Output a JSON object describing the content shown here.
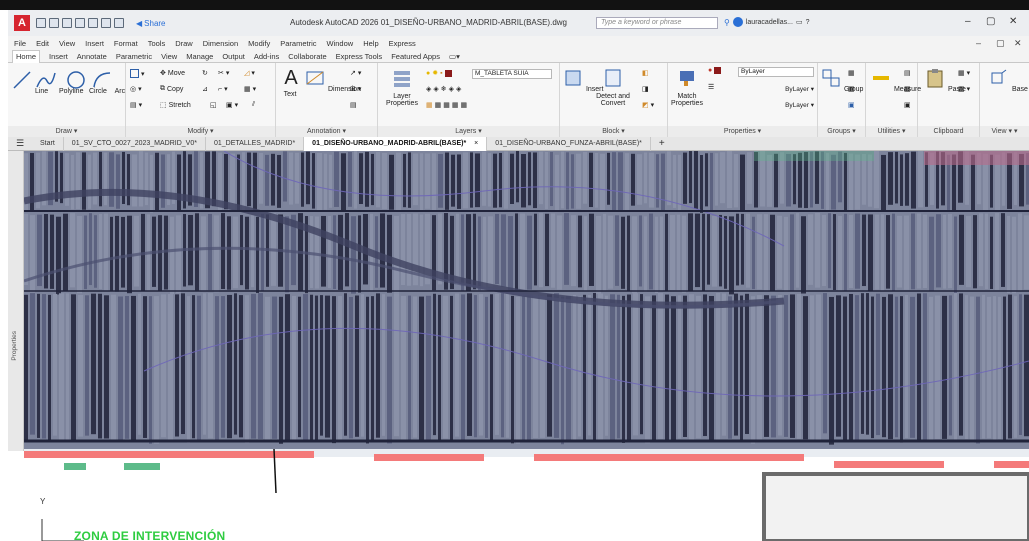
{
  "window": {
    "title": "Autodesk AutoCAD 2026   01_DISEÑO-URBANO_MADRID-ABRIL(BASE).dwg",
    "share_label": "Share",
    "search_placeholder": "Type a keyword or phrase",
    "user_name": "lauracadellas...",
    "win_min": "–",
    "win_max": "▢",
    "win_close": "✕"
  },
  "menu": {
    "items": [
      "File",
      "Edit",
      "View",
      "Insert",
      "Format",
      "Tools",
      "Draw",
      "Dimension",
      "Modify",
      "Parametric",
      "Window",
      "Help",
      "Express"
    ]
  },
  "ribbon_tabs": {
    "items": [
      "Home",
      "Insert",
      "Annotate",
      "Parametric",
      "View",
      "Manage",
      "Output",
      "Add-ins",
      "Collaborate",
      "Express Tools",
      "Featured Apps"
    ],
    "active_index": 0
  },
  "ribbon": {
    "draw": {
      "title": "Draw",
      "line": "Line",
      "polyline": "Polyline",
      "circle": "Circle",
      "arc": "Arc"
    },
    "modify": {
      "title": "Modify",
      "move": "Move",
      "copy": "Copy",
      "stretch": "Stretch"
    },
    "annotation": {
      "title": "Annotation",
      "text": "Text",
      "dimension": "Dimension"
    },
    "layers": {
      "title": "Layers",
      "layer_properties_1": "Layer",
      "layer_properties_2": "Properties",
      "current_layer": "M_TABLETA SUIA"
    },
    "insert": {
      "label": "Insert"
    },
    "block": {
      "title": "Block",
      "detect_1": "Detect and",
      "detect_2": "Convert"
    },
    "properties": {
      "title": "Properties",
      "match_1": "Match",
      "match_2": "Properties",
      "color": "ByLayer",
      "linetype": "ByLayer",
      "lineweight": "ByLayer"
    },
    "groups": {
      "title": "Groups",
      "group": "Group"
    },
    "utilities": {
      "title": "Utilities",
      "measure": "Measure"
    },
    "clipboard": {
      "title": "Clipboard",
      "paste": "Paste"
    },
    "view": {
      "title": "View",
      "base": "Base"
    }
  },
  "file_tabs": {
    "items": [
      {
        "label": "Start",
        "active": false
      },
      {
        "label": "01_SV_CTO_0027_2023_MADRID_V0*",
        "active": false
      },
      {
        "label": "01_DETALLES_MADRID*",
        "active": false
      },
      {
        "label": "01_DISEÑO-URBANO_MADRID-ABRIL(BASE)*",
        "active": true
      },
      {
        "label": "01_DISEÑO-URBANO_FUNZA-ABRIL(BASE)*",
        "active": false
      }
    ],
    "add_label": "+",
    "close_label": "×"
  },
  "sidebar": {
    "properties_label": "Properties"
  },
  "drawing": {
    "zone_label": "ZONA DE INTERVENCIÓN",
    "ucs_y_label": "Y",
    "colors": {
      "block_dark": "#2d3047",
      "block_light": "#8a91a8",
      "block_mid": "#5c6280",
      "curve_band": "#3e4260",
      "road_red": "#f47a7a",
      "road_green": "#5dbb8a",
      "highlight_green": "#2ecc40",
      "magenta_text": "#b44fc8"
    }
  }
}
